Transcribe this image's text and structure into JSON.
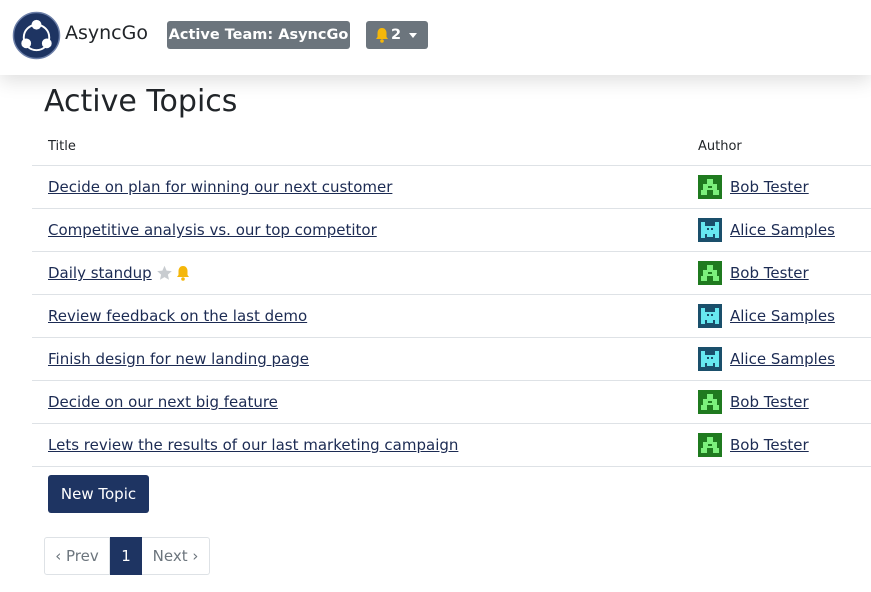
{
  "header": {
    "brand": "AsyncGo",
    "active_team_label": "Active Team: AsyncGo",
    "notification_count": "2"
  },
  "page": {
    "title": "Active Topics"
  },
  "table": {
    "columns": {
      "title": "Title",
      "author": "Author"
    },
    "rows": [
      {
        "title": "Decide on plan for winning our next customer",
        "author": "Bob Tester",
        "avatar": "bob",
        "badges": []
      },
      {
        "title": "Competitive analysis vs. our top competitor",
        "author": "Alice Samples",
        "avatar": "alice",
        "badges": []
      },
      {
        "title": "Daily standup",
        "author": "Bob Tester",
        "avatar": "bob",
        "badges": [
          "star-icon",
          "bell-icon"
        ]
      },
      {
        "title": "Review feedback on the last demo",
        "author": "Alice Samples",
        "avatar": "alice",
        "badges": []
      },
      {
        "title": "Finish design for new landing page",
        "author": "Alice Samples",
        "avatar": "alice",
        "badges": []
      },
      {
        "title": "Decide on our next big feature",
        "author": "Bob Tester",
        "avatar": "bob",
        "badges": []
      },
      {
        "title": "Lets review the results of our last marketing campaign",
        "author": "Bob Tester",
        "avatar": "bob",
        "badges": []
      }
    ]
  },
  "actions": {
    "new_topic_label": "New Topic"
  },
  "pagination": {
    "prev": "‹ Prev",
    "current": "1",
    "next": "Next ›"
  },
  "colors": {
    "primary": "#1e3462",
    "secondary": "#6c757d",
    "link": "#1c2b53",
    "bell": "#f5b70a",
    "star": "#c8ccd0",
    "avatar_bob_bg": "#1f7a1f",
    "avatar_bob_fg": "#7cf07c",
    "avatar_alice_bg": "#1a4f6b",
    "avatar_alice_fg": "#67e8f0"
  }
}
